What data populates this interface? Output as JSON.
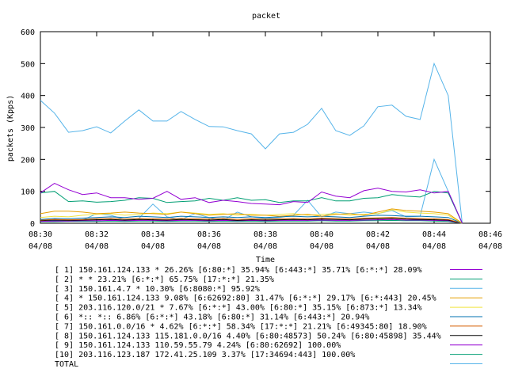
{
  "chart_data": {
    "type": "line",
    "title": "packet",
    "xlabel": "Time",
    "ylabel": "packets (Kpps)",
    "ylim": [
      0,
      600
    ],
    "xlim": [
      "08:30",
      "08:46"
    ],
    "yticks": [
      0,
      100,
      200,
      300,
      400,
      500,
      600
    ],
    "xticks": [
      {
        "time": "08:30",
        "date": "04/08"
      },
      {
        "time": "08:32",
        "date": "04/08"
      },
      {
        "time": "08:34",
        "date": "04/08"
      },
      {
        "time": "08:36",
        "date": "04/08"
      },
      {
        "time": "08:38",
        "date": "04/08"
      },
      {
        "time": "08:40",
        "date": "04/08"
      },
      {
        "time": "08:42",
        "date": "04/08"
      },
      {
        "time": "08:44",
        "date": "04/08"
      },
      {
        "time": "08:46",
        "date": "04/08"
      }
    ],
    "grid": false,
    "legend_position": "bottom",
    "x": [
      "08:30",
      "08:30:30",
      "08:31",
      "08:31:30",
      "08:32",
      "08:32:30",
      "08:33",
      "08:33:30",
      "08:34",
      "08:34:30",
      "08:35",
      "08:35:30",
      "08:36",
      "08:36:30",
      "08:37",
      "08:37:30",
      "08:38",
      "08:38:30",
      "08:39",
      "08:39:30",
      "08:40",
      "08:40:30",
      "08:41",
      "08:41:30",
      "08:42",
      "08:42:30",
      "08:43",
      "08:43:30",
      "08:44",
      "08:44:30",
      "08:45"
    ],
    "series": [
      {
        "name": "[ 1] 150.161.124.133 * 26.26%  [6:80:*] 35.94% [6:443:*] 35.71% [6:*:*] 28.09%",
        "color": "#9400d3",
        "values": [
          95,
          125,
          105,
          90,
          95,
          80,
          80,
          75,
          78,
          100,
          75,
          80,
          65,
          72,
          68,
          62,
          60,
          58,
          68,
          65,
          98,
          85,
          80,
          102,
          110,
          100,
          98,
          105,
          95,
          100,
          0
        ]
      },
      {
        "name": "[ 2] * * 23.21%  [6:*:*] 65.75% [17:*:*] 21.35%",
        "color": "#009e73",
        "values": [
          95,
          100,
          68,
          70,
          66,
          68,
          72,
          80,
          78,
          65,
          68,
          70,
          78,
          72,
          80,
          72,
          74,
          65,
          70,
          70,
          80,
          70,
          70,
          78,
          80,
          90,
          85,
          82,
          100,
          95,
          0
        ]
      },
      {
        "name": "[ 3] 150.161.4.7 * 10.30%  [6:8080:*] 95.92%",
        "color": "#56b4e9",
        "values": [
          385,
          345,
          285,
          290,
          302,
          283,
          320,
          355,
          320,
          320,
          350,
          325,
          303,
          302,
          290,
          280,
          233,
          280,
          285,
          310,
          360,
          290,
          275,
          305,
          365,
          370,
          335,
          325,
          500,
          400,
          0
        ]
      },
      {
        "name": "[ 4] * 150.161.124.133 9.08%  [6:62692:80] 31.47% [6:*:*] 29.17% [6:*:443] 20.45%",
        "color": "#e69f00",
        "values": [
          30,
          38,
          38,
          35,
          30,
          32,
          35,
          32,
          30,
          28,
          35,
          30,
          25,
          28,
          30,
          25,
          25,
          22,
          25,
          28,
          22,
          28,
          30,
          25,
          35,
          45,
          40,
          38,
          35,
          30,
          0
        ]
      },
      {
        "name": "[ 5] 203.116.120.0/21 * 7.67%  [6:*:*] 43.00% [6:80:*] 35.15% [6:873:*] 13.34%",
        "color": "#f0e442",
        "values": [
          18,
          22,
          20,
          25,
          28,
          30,
          25,
          28,
          32,
          30,
          35,
          32,
          28,
          30,
          25,
          28,
          25,
          28,
          30,
          25,
          28,
          30,
          25,
          28,
          30,
          42,
          35,
          32,
          30,
          25,
          0
        ]
      },
      {
        "name": "[ 6] *:: *:: 6.86%  [6:*:*] 43.18% [6:80:*] 31.14% [6:443:*] 20.94%",
        "color": "#0072b2",
        "values": [
          12,
          15,
          14,
          16,
          18,
          20,
          18,
          22,
          20,
          18,
          22,
          20,
          18,
          20,
          18,
          20,
          18,
          20,
          22,
          20,
          22,
          20,
          18,
          22,
          25,
          24,
          22,
          22,
          20,
          18,
          0
        ]
      },
      {
        "name": "[ 7] 150.161.0.0/16 * 4.62%  [6:*:*] 58.34% [17:*:*] 21.21% [6:49345:80] 18.90%",
        "color": "#d55e00",
        "values": [
          10,
          12,
          11,
          12,
          14,
          15,
          13,
          15,
          14,
          13,
          15,
          14,
          13,
          15,
          12,
          14,
          13,
          14,
          15,
          14,
          16,
          15,
          14,
          16,
          17,
          18,
          16,
          15,
          14,
          12,
          0
        ]
      },
      {
        "name": "[ 8] 150.161.124.133 115.181.0.0/16 4.40%  [6:80:48573] 50.24% [6:80:45898] 35.44%",
        "color": "#000000",
        "values": [
          8,
          10,
          9,
          10,
          11,
          12,
          10,
          12,
          11,
          10,
          12,
          11,
          10,
          12,
          9,
          11,
          10,
          11,
          12,
          11,
          13,
          12,
          11,
          13,
          14,
          15,
          13,
          12,
          11,
          10,
          0
        ]
      },
      {
        "name": "[ 9] 150.161.124.133 110.59.55.79 4.24%  [6:80:62692] 100.00%",
        "color": "#9400d3",
        "values": [
          6,
          7,
          7,
          8,
          8,
          9,
          8,
          9,
          9,
          8,
          9,
          9,
          8,
          9,
          8,
          9,
          8,
          9,
          9,
          9,
          10,
          9,
          9,
          10,
          11,
          12,
          10,
          10,
          9,
          8,
          0
        ]
      },
      {
        "name": "[10] 203.116.123.187 172.41.25.109 3.37%  [17:34694:443] 100.00%",
        "color": "#009e73",
        "values": [
          5,
          5,
          6,
          6,
          6,
          7,
          6,
          7,
          7,
          6,
          7,
          7,
          6,
          7,
          6,
          7,
          6,
          7,
          7,
          7,
          8,
          7,
          7,
          8,
          8,
          9,
          8,
          8,
          7,
          6,
          0
        ]
      },
      {
        "name": "TOTAL",
        "color": "#56b4e9",
        "values": [
          5,
          8,
          6,
          10,
          30,
          25,
          12,
          15,
          60,
          20,
          12,
          30,
          18,
          10,
          35,
          20,
          15,
          18,
          25,
          72,
          20,
          35,
          30,
          35,
          30,
          40,
          20,
          22,
          200,
          100,
          0
        ]
      }
    ]
  }
}
